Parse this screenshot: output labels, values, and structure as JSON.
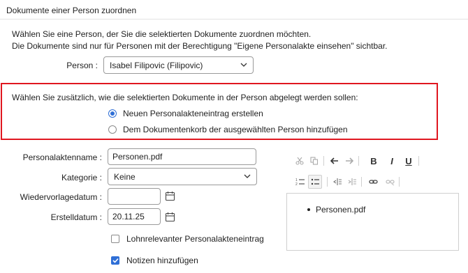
{
  "dialog": {
    "title": "Dokumente einer Person zuordnen",
    "intro_line1": "Wählen Sie eine Person, der Sie die selektierten Dokumente zuordnen möchten.",
    "intro_line2": "Die Dokumente sind nur für Personen mit der Berechtigung \"Eigene Personalakte einsehen\" sichtbar.",
    "person_label": "Person :",
    "person_value": "Isabel Filipovic (Filipovic)"
  },
  "placement": {
    "question": "Wählen Sie zusätzlich, wie die selektierten Dokumente in der Person abgelegt werden sollen:",
    "options": [
      {
        "label": "Neuen Personalakteneintrag erstellen",
        "selected": true
      },
      {
        "label": "Dem Dokumentenkorb der ausgewählten Person hinzufügen",
        "selected": false
      }
    ]
  },
  "form": {
    "name_label": "Personalaktenname :",
    "name_value": "Personen.pdf",
    "category_label": "Kategorie :",
    "category_value": "Keine",
    "resubmission_label": "Wiedervorlagedatum :",
    "resubmission_value": "",
    "created_label": "Erstelldatum :",
    "created_value": "20.11.25",
    "payroll_label": "Lohnrelevanter Personalakteneintrag",
    "payroll_checked": false,
    "notes_label": "Notizen hinzufügen",
    "notes_checked": true
  },
  "editor": {
    "items": [
      "Personen.pdf"
    ],
    "toolbar": [
      "cut-icon",
      "copy-icon",
      "undo-icon",
      "redo-icon",
      "bold-icon",
      "italic-icon",
      "underline-icon",
      "numbered-list-icon",
      "bulleted-list-icon",
      "outdent-icon",
      "indent-icon",
      "link-icon",
      "unlink-icon"
    ]
  },
  "colors": {
    "accent": "#2f6fd6",
    "highlight_border": "#e0161f"
  }
}
